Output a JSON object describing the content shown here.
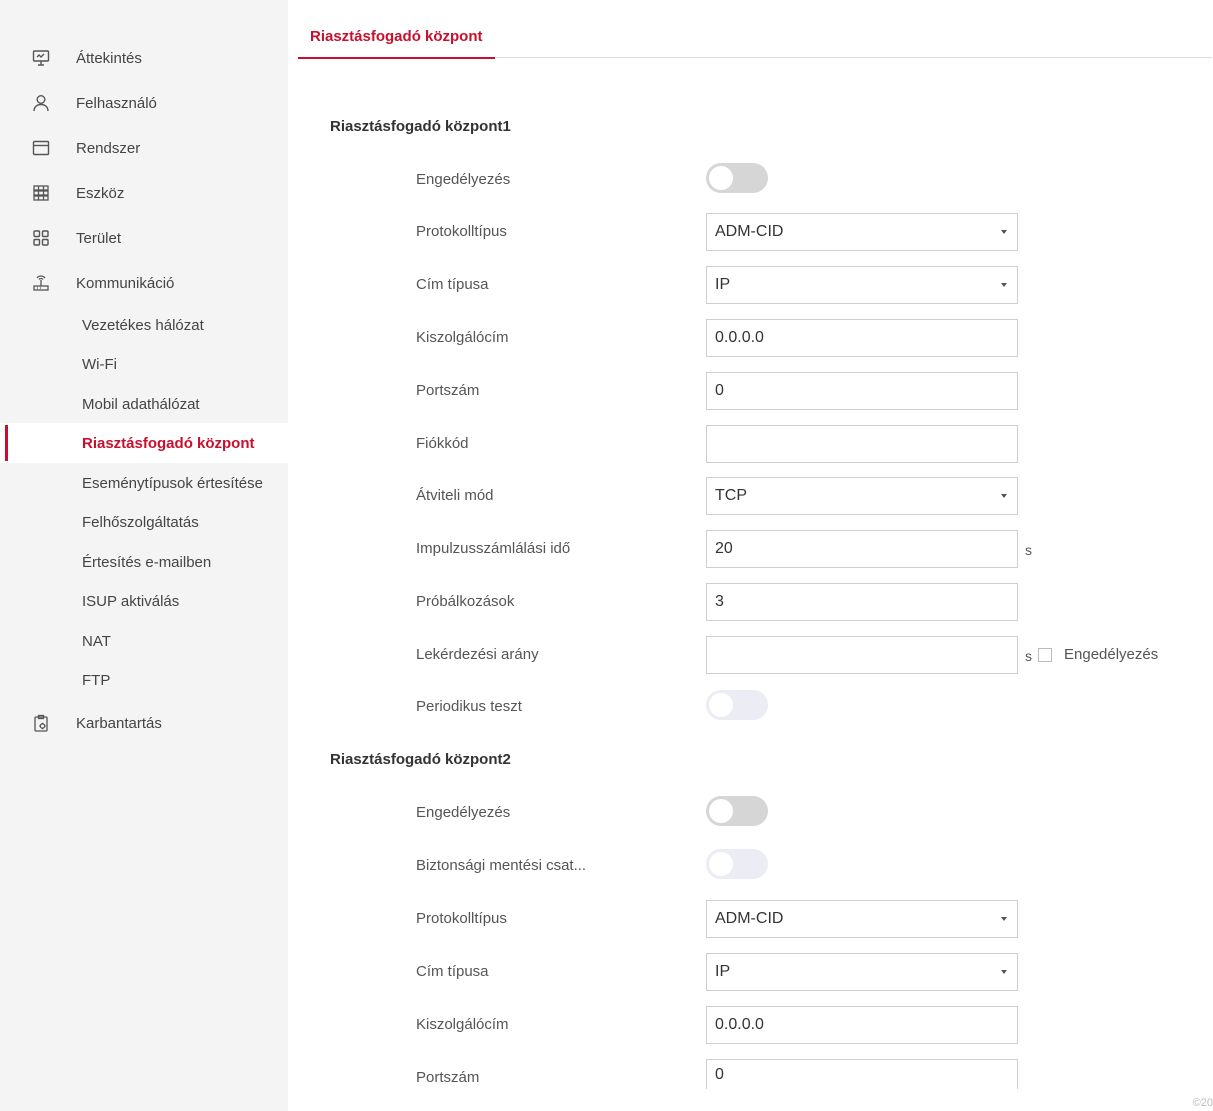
{
  "sidebar": {
    "items": [
      {
        "label": "Áttekintés",
        "icon": "monitor-icon"
      },
      {
        "label": "Felhasználó",
        "icon": "user-icon"
      },
      {
        "label": "Rendszer",
        "icon": "window-icon"
      },
      {
        "label": "Eszköz",
        "icon": "device-grid-icon"
      },
      {
        "label": "Terület",
        "icon": "area-grid-icon"
      },
      {
        "label": "Kommunikáció",
        "icon": "antenna-icon"
      }
    ],
    "sub_items": [
      {
        "label": "Vezetékes hálózat"
      },
      {
        "label": "Wi-Fi"
      },
      {
        "label": "Mobil adathálózat"
      },
      {
        "label": "Riasztásfogadó központ",
        "active": true
      },
      {
        "label": "Eseménytípusok értesítése"
      },
      {
        "label": "Felhőszolgáltatás"
      },
      {
        "label": "Értesítés e-mailben"
      },
      {
        "label": "ISUP aktiválás"
      },
      {
        "label": "NAT"
      },
      {
        "label": "FTP"
      }
    ],
    "maintenance": {
      "label": "Karbantartás",
      "icon": "clipboard-gear-icon"
    }
  },
  "tab": {
    "label": "Riasztásfogadó központ"
  },
  "center1": {
    "title": "Riasztásfogadó központ1",
    "enable_label": "Engedélyezés",
    "protocol_label": "Protokolltípus",
    "protocol_value": "ADM-CID",
    "address_type_label": "Cím típusa",
    "address_type_value": "IP",
    "server_label": "Kiszolgálócím",
    "server_value": "0.0.0.0",
    "port_label": "Portszám",
    "port_value": "0",
    "account_label": "Fiókkód",
    "account_value": "",
    "transmission_label": "Átviteli mód",
    "transmission_value": "TCP",
    "impulse_label": "Impulzusszámlálási idő",
    "impulse_value": "20",
    "impulse_unit": "s",
    "attempts_label": "Próbálkozások",
    "attempts_value": "3",
    "polling_label": "Lekérdezési arány",
    "polling_value": "",
    "polling_unit": "s",
    "polling_enable_label": "Engedélyezés",
    "periodic_label": "Periodikus teszt"
  },
  "center2": {
    "title": "Riasztásfogadó központ2",
    "enable_label": "Engedélyezés",
    "backup_label": "Biztonsági mentési csat...",
    "protocol_label": "Protokolltípus",
    "protocol_value": "ADM-CID",
    "address_type_label": "Cím típusa",
    "address_type_value": "IP",
    "server_label": "Kiszolgálócím",
    "server_value": "0.0.0.0",
    "port_label": "Portszám",
    "port_value": "0"
  },
  "footer": {
    "copyright": "©20"
  },
  "colors": {
    "accent": "#c8102e",
    "sidebar_bg": "#f4f4f4",
    "toggle_off": "#d6d6d6"
  }
}
